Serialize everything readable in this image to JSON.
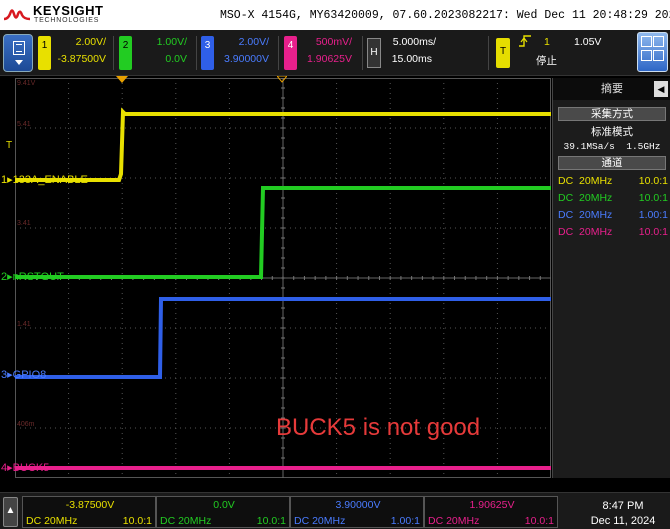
{
  "colors": {
    "ch1": "#e8e000",
    "ch2": "#22cc22",
    "ch3": "#2f5fe8",
    "ch4": "#e8208c",
    "annotation": "#e63a3a",
    "trigger": "#e8a000"
  },
  "header": {
    "brand": "KEYSIGHT",
    "brand_sub": "TECHNOLOGIES",
    "instrument_info": "MSO-X 4154G, MY63420009, 07.60.2023082217: Wed Dec 11 20:48:29 2024"
  },
  "toolbar": {
    "menu_icon": "menu-icon",
    "channels": [
      {
        "num": "1",
        "scale": "2.00V/",
        "offset": "-3.87500V"
      },
      {
        "num": "2",
        "scale": "1.00V/",
        "offset": "0.0V"
      },
      {
        "num": "3",
        "scale": "2.00V/",
        "offset": "3.90000V"
      },
      {
        "num": "4",
        "scale": "500mV/",
        "offset": "1.90625V"
      }
    ],
    "horizontal": {
      "label": "H",
      "time_per_div": "5.000ms/",
      "delay": "15.00ms"
    },
    "trigger": {
      "label": "T",
      "edge_icon": "rising-edge-icon",
      "source": "1",
      "level": "1.05V",
      "status": "停止"
    },
    "touch_icon": "touch-screen-icon"
  },
  "waveform": {
    "labels": [
      {
        "num": "1",
        "name": "133A_ENABLE"
      },
      {
        "num": "2",
        "name": "nRSTOUT"
      },
      {
        "num": "3",
        "name": "GPIO8"
      },
      {
        "num": "4",
        "name": "BUCK5"
      }
    ],
    "trigger_marker": "T",
    "scale_labels": [
      "9.41V",
      "5.41",
      "3.41",
      "1.41",
      "406m"
    ],
    "annotation": "BUCK5 is not good"
  },
  "right_panel": {
    "title": "摘要",
    "acquisition_header": "采集方式",
    "acquisition_mode": "标准模式",
    "sample_rate": "39.1MSa/s",
    "memory_depth": "1.5GHz",
    "channels_header": "通道",
    "channel_rows": [
      {
        "coupling": "DC",
        "bw": "20MHz",
        "probe": "10.0:1"
      },
      {
        "coupling": "DC",
        "bw": "20MHz",
        "probe": "10.0:1"
      },
      {
        "coupling": "DC",
        "bw": "20MHz",
        "probe": "1.00:1"
      },
      {
        "coupling": "DC",
        "bw": "20MHz",
        "probe": "10.0:1"
      }
    ]
  },
  "bottom": {
    "up_icon": "up-arrow-icon",
    "channels": [
      {
        "offset": "-3.87500V",
        "coupling": "DC",
        "bw": "20MHz",
        "probe": "10.0:1"
      },
      {
        "offset": "0.0V",
        "coupling": "DC",
        "bw": "20MHz",
        "probe": "10.0:1"
      },
      {
        "offset": "3.90000V",
        "coupling": "DC",
        "bw": "20MHz",
        "probe": "1.00:1"
      },
      {
        "offset": "1.90625V",
        "coupling": "DC",
        "bw": "20MHz",
        "probe": "10.0:1"
      }
    ],
    "time": "8:47 PM",
    "date": "Dec 11, 2024"
  }
}
